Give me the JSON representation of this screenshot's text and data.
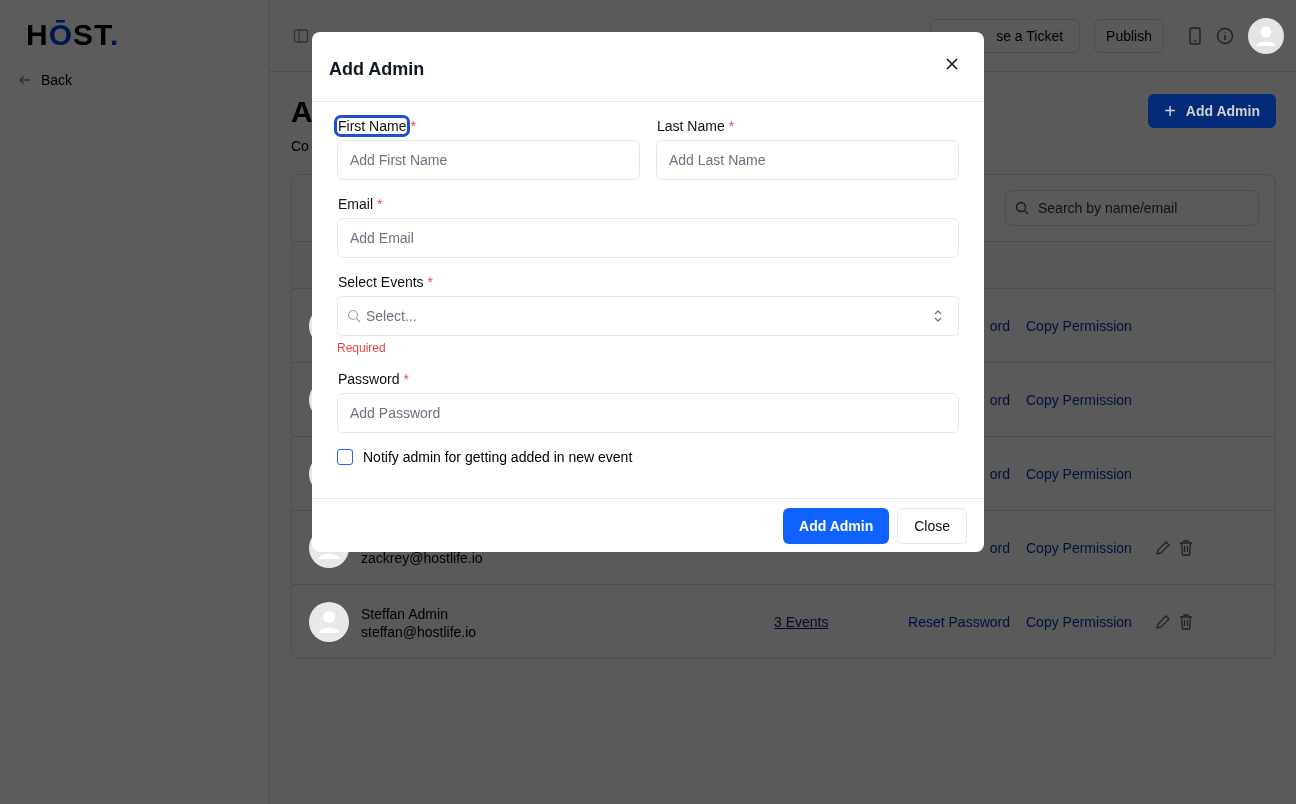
{
  "sidebar": {
    "logo": "HŌST.",
    "back": "Back"
  },
  "topbar": {
    "ticket_button": "se a Ticket",
    "publish_button": "Publish"
  },
  "page": {
    "title": "A",
    "subtitle": "Co",
    "add_button_icon": "+",
    "add_button": "Add Admin",
    "search": {
      "placeholder": "Search by name/email"
    }
  },
  "rows": [
    {
      "reset": "ord",
      "copy": "Copy Permission",
      "actions": false
    },
    {
      "reset": "ord",
      "copy": "Copy Permission",
      "actions": false
    },
    {
      "reset": "ord",
      "copy": "Copy Permission",
      "actions": false
    },
    {
      "email": "zackrey@hostlife.io",
      "reset": "ord",
      "copy": "Copy Permission",
      "actions": true
    },
    {
      "name": "Steffan Admin",
      "email": "steffan@hostlife.io",
      "events": "3 Events",
      "reset": "Reset Password",
      "copy": "Copy Permission",
      "actions": true
    }
  ],
  "modal": {
    "title": "Add Admin",
    "fields": [
      {
        "label": "First Name",
        "required_mark": "*",
        "focused": true,
        "placeholder": "Add First Name",
        "kind": "text"
      },
      {
        "label": "Last Name",
        "required_mark": "*",
        "focused": false,
        "placeholder": "Add Last Name",
        "kind": "text"
      },
      {
        "label": "Email",
        "required_mark": "*",
        "focused": false,
        "placeholder": "Add Email",
        "kind": "text"
      },
      {
        "label": "Select Events",
        "required_mark": "*",
        "focused": false,
        "placeholder": "Select...",
        "kind": "select",
        "error": "Required"
      },
      {
        "label": "Password",
        "required_mark": "*",
        "focused": false,
        "placeholder": "Add Password",
        "kind": "text"
      }
    ],
    "notify": {
      "label": "Notify admin for getting added in new event",
      "checked": false
    },
    "buttons": [
      {
        "label": "Add Admin",
        "primary": true
      },
      {
        "label": "Close",
        "primary": false
      }
    ]
  }
}
